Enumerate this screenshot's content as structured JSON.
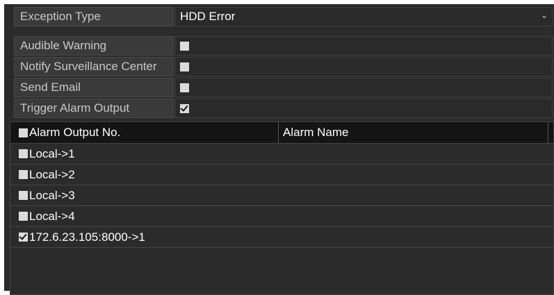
{
  "settings": [
    {
      "label": "Exception Type",
      "type": "select",
      "value": "HDD Error"
    },
    {
      "label": "Audible Warning",
      "type": "checkbox",
      "checked": false
    },
    {
      "label": "Notify Surveillance Center",
      "type": "checkbox",
      "checked": false
    },
    {
      "label": "Send Email",
      "type": "checkbox",
      "checked": false
    },
    {
      "label": "Trigger Alarm Output",
      "type": "checkbox",
      "checked": true
    }
  ],
  "table": {
    "headers": [
      "Alarm Output No.",
      "Alarm Name"
    ],
    "header_checked": false,
    "rows": [
      {
        "label": "Local->1",
        "checked": false
      },
      {
        "label": "Local->2",
        "checked": false
      },
      {
        "label": "Local->3",
        "checked": false
      },
      {
        "label": "Local->4",
        "checked": false
      },
      {
        "label": "172.6.23.105:8000->1",
        "checked": true
      }
    ]
  },
  "icons": {
    "dropdown": "chevron-down-icon",
    "checkbox_checked": "checkmark-icon"
  },
  "colors": {
    "panel_bg": "#2b2b2b",
    "header_bg": "#141414",
    "checkbox": "#dcdcdc",
    "label_text": "#c8c8c8"
  }
}
